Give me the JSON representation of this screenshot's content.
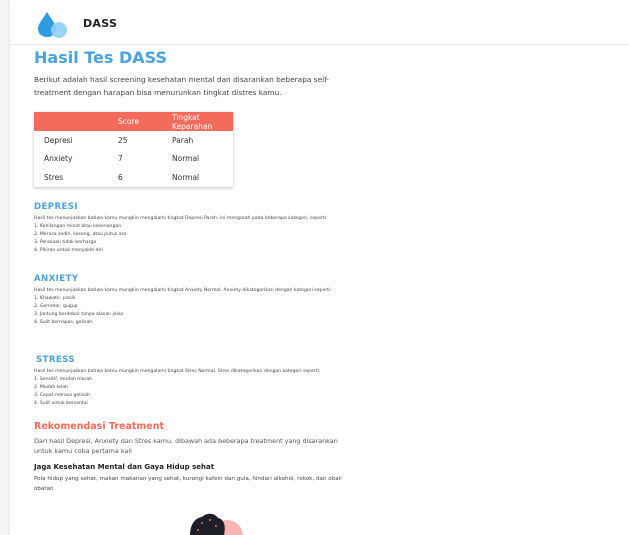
{
  "header": {
    "brand": "DASS"
  },
  "main": {
    "title": "Hasil Tes DASS",
    "intro": "Berikut adalah hasil screening kesehatan mental dan disarankan beberapa self-treatment dengan harapan bisa menurunkan tingkat distres kamu.",
    "table": {
      "headers": [
        "",
        "Score",
        "Tingkat Keparahan"
      ],
      "rows": [
        {
          "label": "Depresi",
          "score": "25",
          "level": "Parah"
        },
        {
          "label": "Anxiety",
          "score": "7",
          "level": "Normal"
        },
        {
          "label": "Stres",
          "score": "6",
          "level": "Normal"
        }
      ]
    },
    "sections": {
      "depresi": {
        "title": "DEPRESI",
        "desc": "Hasil tes menunjukkan bahwa kamu mungkin mengalami tingkat Depresi Parah, ini mengarah pada beberapa kategori, seperti:",
        "items": [
          "1. Kehilangan minat atau kesenangan",
          "2. Merasa sedih, kosong, atau putus asa",
          "3. Perasaan tidak berharga",
          "4. Pikiran untuk menyakiti diri"
        ]
      },
      "anxiety": {
        "title": "ANXIETY",
        "desc": "Hasil tes menunjukkan bahwa kamu mungkin mengalami tingkat Anxiety Normal. Anxiety dikategorikan dengan kategori seperti:",
        "items": [
          "1. Khawatir, panik",
          "2. Gemetar, gugup",
          "3. Jantung berdebar tanpa alasan jelas",
          "4. Sulit bernapas, gelisah"
        ]
      },
      "stress": {
        "title": "STRESS",
        "desc": "Hasil tes menunjukkan bahwa kamu mungkin mengalami tingkat Stres Normal. Stres dikategorikan dengan kategori seperti:",
        "items": [
          "1. Sensitif, mudah marah",
          "2. Mudah lelah",
          "3. Cepat merasa gelisah",
          "4. Sulit untuk bersantai"
        ]
      }
    },
    "recommendation": {
      "title": "Rekomendasi Treatment",
      "subtitle": "Dari hasil Depresi, Anxiety dan Stres kamu, dibawah ada beberapa treatment yang disarankan untuk kamu coba pertama kali",
      "heading": "Jaga Kesehatan Mental dan Gaya Hidup sehat",
      "text": "Pola hidup yang sehat, makan makanan yang sehat, kurangi kafein dan gula, hindari alkohol, rokok, dan obat-obatan"
    }
  },
  "colors": {
    "accent": "#4aa3df",
    "table_header": "#f26b5b",
    "recommendation": "#f26b5b"
  },
  "icons": {
    "logo": "water-drop-logo-icon"
  }
}
